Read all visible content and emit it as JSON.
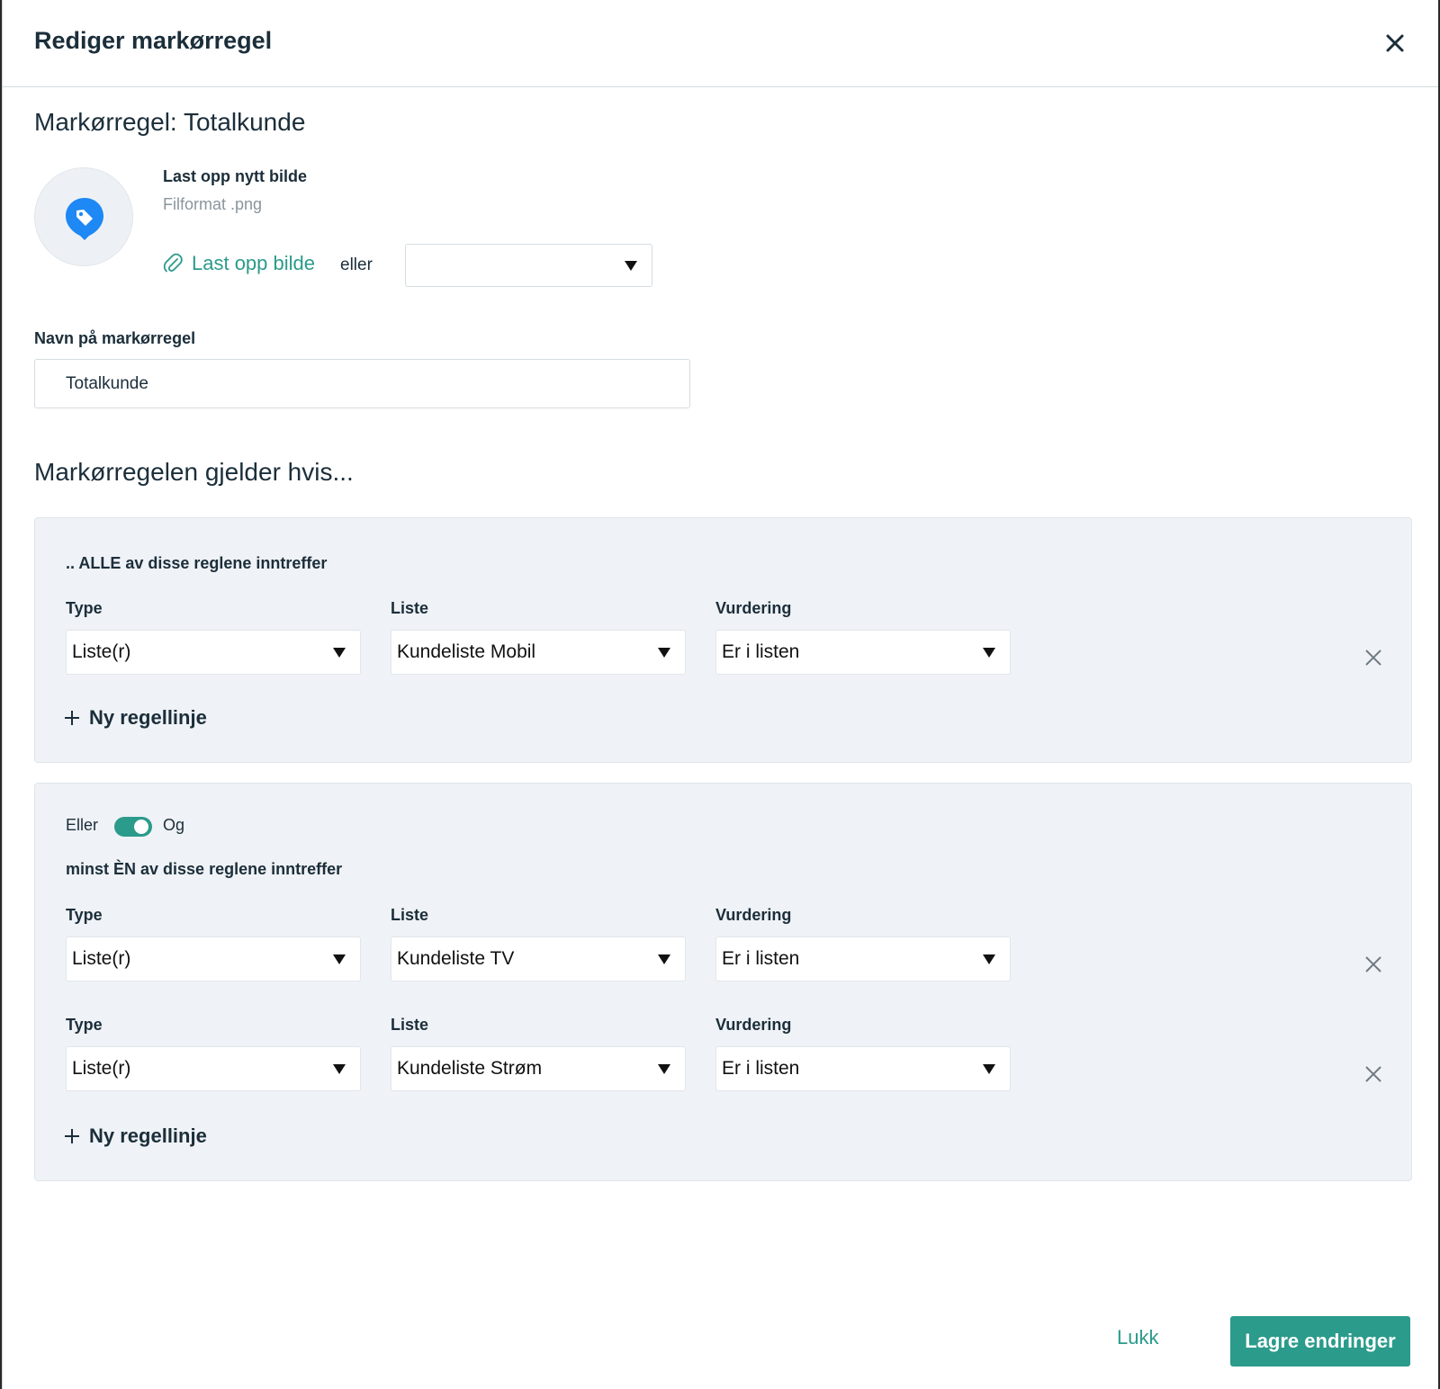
{
  "dialog": {
    "title": "Rediger markørregel"
  },
  "rule": {
    "title": "Markørregel: Totalkunde"
  },
  "upload": {
    "heading": "Last opp nytt bilde",
    "format": "Filformat .png",
    "link_label": "Last opp bilde",
    "or_label": "eller",
    "icon_select_value": ""
  },
  "name_field": {
    "label": "Navn på markørregel",
    "value": "Totalkunde"
  },
  "conditions": {
    "heading": "Markørregelen gjelder hvis..."
  },
  "groups": [
    {
      "caption": ".. ALLE av disse reglene inntreffer",
      "rows": [
        {
          "type_label": "Type",
          "type_value": "Liste(r)",
          "list_label": "Liste",
          "list_value": "Kundeliste Mobil",
          "rating_label": "Vurdering",
          "rating_value": "Er i listen"
        }
      ],
      "add_line_label": "Ny regellinje"
    },
    {
      "toggle_left": "Eller",
      "toggle_right": "Og",
      "toggle_on": true,
      "caption": "minst ÈN av disse reglene inntreffer",
      "rows": [
        {
          "type_label": "Type",
          "type_value": "Liste(r)",
          "list_label": "Liste",
          "list_value": "Kundeliste TV",
          "rating_label": "Vurdering",
          "rating_value": "Er i listen"
        },
        {
          "type_label": "Type",
          "type_value": "Liste(r)",
          "list_label": "Liste",
          "list_value": "Kundeliste Strøm",
          "rating_label": "Vurdering",
          "rating_value": "Er i listen"
        }
      ],
      "add_line_label": "Ny regellinje"
    }
  ],
  "footer": {
    "close_label": "Lukk",
    "save_label": "Lagre endringer"
  },
  "colors": {
    "accent": "#2b9b8b",
    "marker_blue": "#1e88f5",
    "group_bg": "#eff2f6",
    "text": "#1b2e3a"
  },
  "icons": {
    "close": "close-icon",
    "marker": "tag-marker-icon",
    "attach": "paperclip-icon",
    "add": "plus-icon",
    "remove": "remove-row-icon",
    "dropdown": "caret-down-icon"
  }
}
